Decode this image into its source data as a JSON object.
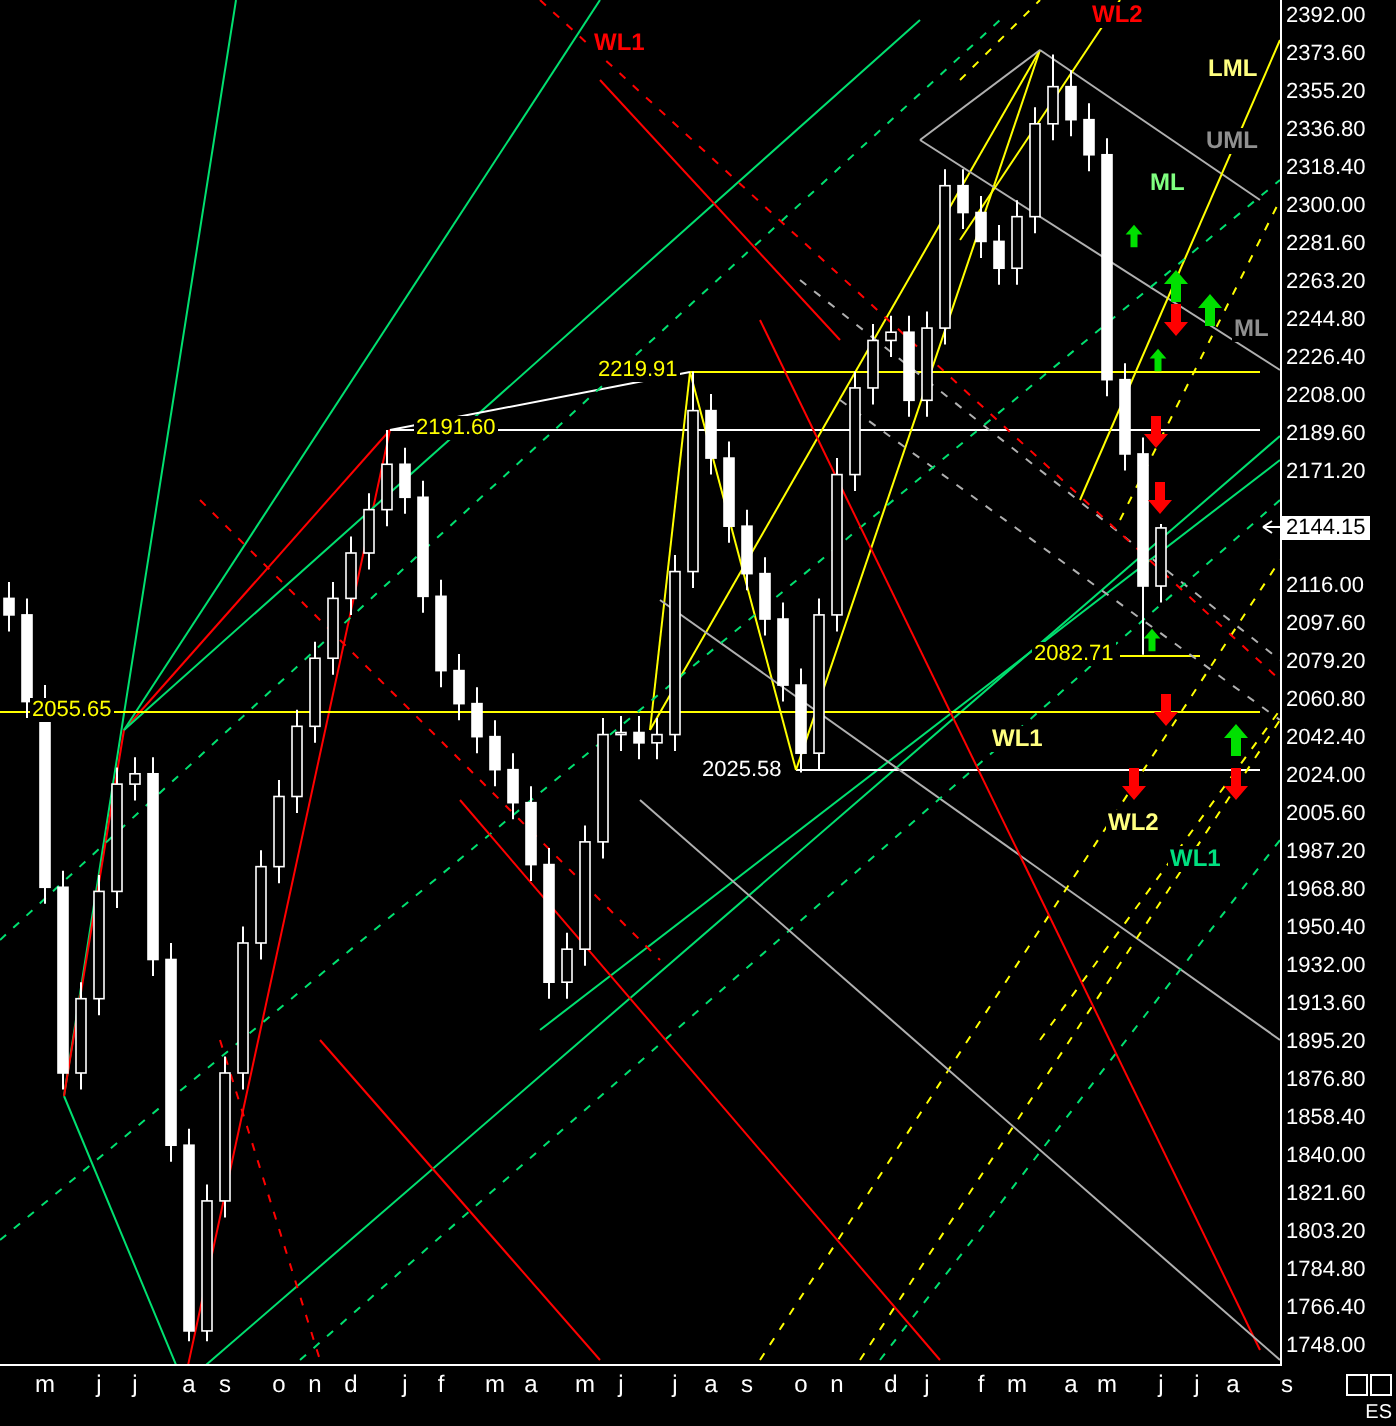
{
  "chart": {
    "chart_data": {
      "type": "candlestick",
      "ylim": [
        1738,
        2400
      ],
      "categories": [
        null,
        null,
        "m",
        null,
        null,
        "j",
        null,
        "j",
        null,
        null,
        "a",
        null,
        "s",
        null,
        null,
        "o",
        null,
        "n",
        null,
        "d",
        null,
        null,
        "j",
        null,
        "f",
        null,
        null,
        "m",
        null,
        "a",
        null,
        null,
        "m",
        null,
        "j",
        null,
        null,
        "j",
        null,
        "a",
        null,
        "s",
        null,
        null,
        "o",
        null,
        "n",
        null,
        null,
        "d",
        null,
        "j",
        null,
        null,
        "f",
        null,
        "m",
        null,
        null,
        "a",
        null,
        "m",
        null,
        null,
        "j",
        null,
        "j",
        null,
        "a",
        null,
        null,
        "s"
      ],
      "yticks": [
        {
          "value": 2392,
          "label": "2392.00"
        },
        {
          "value": 2373.6,
          "label": "2373.60"
        },
        {
          "value": 2355.2,
          "label": "2355.20"
        },
        {
          "value": 2336.8,
          "label": "2336.80"
        },
        {
          "value": 2318.4,
          "label": "2318.40"
        },
        {
          "value": 2300,
          "label": "2300.00"
        },
        {
          "value": 2281.6,
          "label": "2281.60"
        },
        {
          "value": 2263.2,
          "label": "2263.20"
        },
        {
          "value": 2244.8,
          "label": "2244.80"
        },
        {
          "value": 2226.4,
          "label": "2226.40"
        },
        {
          "value": 2208,
          "label": "2208.00"
        },
        {
          "value": 2189.6,
          "label": "2189.60"
        },
        {
          "value": 2171.2,
          "label": "2171.20"
        },
        {
          "value": 2116,
          "label": "2116.00"
        },
        {
          "value": 2097.6,
          "label": "2097.60"
        },
        {
          "value": 2079.2,
          "label": "2079.20"
        },
        {
          "value": 2060.8,
          "label": "2060.80"
        },
        {
          "value": 2042.4,
          "label": "2042.40"
        },
        {
          "value": 2024,
          "label": "2024.00"
        },
        {
          "value": 2005.6,
          "label": "2005.60"
        },
        {
          "value": 1987.2,
          "label": "1987.20"
        },
        {
          "value": 1968.8,
          "label": "1968.80"
        },
        {
          "value": 1950.4,
          "label": "1950.40"
        },
        {
          "value": 1932,
          "label": "1932.00"
        },
        {
          "value": 1913.6,
          "label": "1913.60"
        },
        {
          "value": 1895.2,
          "label": "1895.20"
        },
        {
          "value": 1876.8,
          "label": "1876.80"
        },
        {
          "value": 1858.4,
          "label": "1858.40"
        },
        {
          "value": 1840,
          "label": "1840.00"
        },
        {
          "value": 1821.6,
          "label": "1821.60"
        },
        {
          "value": 1803.2,
          "label": "1803.20"
        },
        {
          "value": 1784.8,
          "label": "1784.80"
        },
        {
          "value": 1766.4,
          "label": "1766.40"
        },
        {
          "value": 1748,
          "label": "1748.00"
        }
      ],
      "ohlc": [
        [
          2110,
          2118,
          2094,
          2102
        ],
        [
          2102,
          2110,
          2052,
          2060
        ],
        [
          2060,
          2068,
          1962,
          1970
        ],
        [
          1970,
          1978,
          1872,
          1880
        ],
        [
          1880,
          1924,
          1872,
          1916
        ],
        [
          1916,
          1976,
          1908,
          1968
        ],
        [
          1968,
          2028,
          1960,
          2020
        ],
        [
          2020,
          2033,
          2012,
          2025
        ],
        [
          2025,
          2033,
          1927,
          1935
        ],
        [
          1935,
          1943,
          1837,
          1845
        ],
        [
          1845,
          1853,
          1750,
          1755
        ],
        [
          1755,
          1826,
          1750,
          1818
        ],
        [
          1818,
          1888,
          1810,
          1880
        ],
        [
          1880,
          1951,
          1872,
          1943
        ],
        [
          1943,
          1988,
          1935,
          1980
        ],
        [
          1980,
          2022,
          1972,
          2014
        ],
        [
          2014,
          2056,
          2006,
          2048
        ],
        [
          2048,
          2089,
          2040,
          2081
        ],
        [
          2081,
          2118,
          2073,
          2110
        ],
        [
          2110,
          2140,
          2102,
          2132
        ],
        [
          2132,
          2161,
          2124,
          2153
        ],
        [
          2153,
          2191.6,
          2145,
          2175
        ],
        [
          2175,
          2183,
          2151,
          2159
        ],
        [
          2159,
          2167,
          2103,
          2111
        ],
        [
          2111,
          2119,
          2067,
          2075
        ],
        [
          2075,
          2083,
          2051,
          2059
        ],
        [
          2059,
          2067,
          2035,
          2043
        ],
        [
          2043,
          2051,
          2019,
          2027
        ],
        [
          2027,
          2035,
          2003,
          2011
        ],
        [
          2011,
          2019,
          1973,
          1981
        ],
        [
          1981,
          1989,
          1916,
          1924
        ],
        [
          1924,
          1948,
          1916,
          1940
        ],
        [
          1940,
          2000,
          1932,
          1992
        ],
        [
          1992,
          2052,
          1984,
          2044
        ],
        [
          2044,
          2053,
          2036,
          2045
        ],
        [
          2045,
          2053,
          2032,
          2040
        ],
        [
          2040,
          2052,
          2032,
          2044
        ],
        [
          2044,
          2131,
          2036,
          2123
        ],
        [
          2123,
          2219.91,
          2115,
          2201
        ],
        [
          2201,
          2209,
          2170,
          2178
        ],
        [
          2178,
          2186,
          2137,
          2145
        ],
        [
          2145,
          2153,
          2114,
          2122
        ],
        [
          2122,
          2130,
          2092,
          2100
        ],
        [
          2100,
          2108,
          2060,
          2068
        ],
        [
          2068,
          2076,
          2025.58,
          2035
        ],
        [
          2035,
          2110,
          2027,
          2102
        ],
        [
          2102,
          2178,
          2094,
          2170
        ],
        [
          2170,
          2220,
          2162,
          2212
        ],
        [
          2212,
          2243,
          2204,
          2235
        ],
        [
          2235,
          2247,
          2227,
          2239
        ],
        [
          2239,
          2247,
          2198,
          2206
        ],
        [
          2206,
          2249,
          2198,
          2241
        ],
        [
          2241,
          2318,
          2233,
          2310
        ],
        [
          2310,
          2318,
          2289,
          2297
        ],
        [
          2297,
          2305,
          2275,
          2283
        ],
        [
          2283,
          2291,
          2262,
          2270
        ],
        [
          2270,
          2303,
          2262,
          2295
        ],
        [
          2295,
          2348,
          2287,
          2340
        ],
        [
          2340,
          2373.6,
          2332,
          2358
        ],
        [
          2358,
          2366,
          2334,
          2342
        ],
        [
          2342,
          2350,
          2317,
          2325
        ],
        [
          2325,
          2333,
          2208,
          2216
        ],
        [
          2216,
          2224,
          2172,
          2180
        ],
        [
          2180,
          2188,
          2082.71,
          2116
        ],
        [
          2116,
          2146,
          2108,
          2144.15
        ],
        null,
        null,
        null,
        null,
        null,
        null,
        null
      ]
    },
    "current_price": "2144.15",
    "price_labels": [
      {
        "text": "2219.91",
        "color": "#ffff00"
      },
      {
        "text": "2191.60",
        "color": "#ffff00"
      },
      {
        "text": "2055.65",
        "color": "#ffff00"
      },
      {
        "text": "2025.58",
        "color": "#ffffff"
      },
      {
        "text": "2082.71",
        "color": "#ffff00"
      }
    ],
    "line_labels": [
      {
        "text": "WL1",
        "color": "#ff0000"
      },
      {
        "text": "WL2",
        "color": "#ff0000"
      },
      {
        "text": "LML",
        "color": "#ffff80"
      },
      {
        "text": "UML",
        "color": "#909090"
      },
      {
        "text": "ML",
        "color": "#80ff80"
      },
      {
        "text": "ML",
        "color": "#909090"
      },
      {
        "text": "WL1",
        "color": "#ffff80"
      },
      {
        "text": "WL2",
        "color": "#ffff80"
      },
      {
        "text": "WL1",
        "color": "#00e080"
      }
    ],
    "signals": [
      {
        "kind": "up"
      },
      {
        "kind": "up"
      },
      {
        "kind": "down"
      },
      {
        "kind": "up"
      },
      {
        "kind": "up"
      },
      {
        "kind": "down"
      },
      {
        "kind": "down"
      },
      {
        "kind": "up"
      },
      {
        "kind": "down"
      },
      {
        "kind": "up"
      },
      {
        "kind": "down"
      },
      {
        "kind": "down"
      }
    ],
    "symbol": "ES"
  }
}
